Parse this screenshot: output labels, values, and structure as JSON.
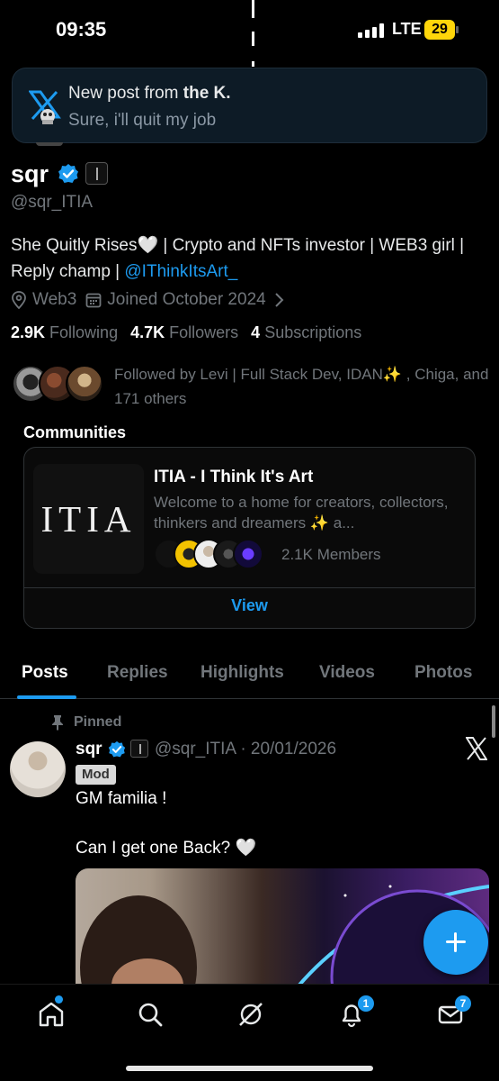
{
  "status_bar": {
    "time": "09:35",
    "network": "LTE",
    "battery": "29"
  },
  "toast": {
    "prefix": "New post from ",
    "author": "the K.",
    "body": "Sure, i'll quit my job"
  },
  "profile": {
    "name": "sqr",
    "handle": "@sqr_ITIA",
    "bio_text": "She Quitly Rises🤍 | Crypto and NFTs investor | WEB3 girl | Reply champ | ",
    "bio_link": "@IThinkItsArt_",
    "location": "Web3",
    "joined": "Joined October 2024",
    "following_count": "2.9K",
    "following_label": "Following",
    "followers_count": "4.7K",
    "followers_label": "Followers",
    "subscriptions_count": "4",
    "subscriptions_label": "Subscriptions",
    "followed_by": "Followed by Levi | Full Stack Dev, IDAN✨ , Chiga, and 171 others"
  },
  "communities": {
    "section_title": "Communities",
    "card": {
      "logo_text": "ITIA",
      "name": "ITIA - I Think It's Art",
      "description": "Welcome to a home for creators, collectors, thinkers and dreamers ✨ a...",
      "members": "2.1K Members",
      "view_label": "View"
    }
  },
  "tabs": [
    "Posts",
    "Replies",
    "Highlights",
    "Videos",
    "Photos"
  ],
  "post": {
    "pinned_label": "Pinned",
    "name": "sqr",
    "handle_date": "@sqr_ITIA · 20/01/2026",
    "role_badge": "Mod",
    "line1": "GM familia !",
    "line2": "Can I get one Back? 🤍"
  },
  "bottom_nav": {
    "notifications_badge": "1",
    "messages_badge": "7"
  },
  "colors": {
    "accent": "#1d9bf0",
    "background": "#000000",
    "muted": "#71767b",
    "battery": "#ffd60a"
  }
}
